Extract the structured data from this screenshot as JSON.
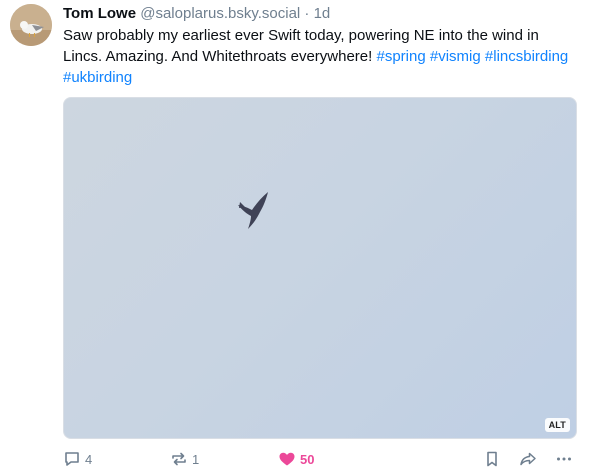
{
  "post": {
    "author": "Tom Lowe",
    "handle": "@saloplarus.bsky.social",
    "separator": "·",
    "time": "1d",
    "text_main": "Saw probably my earliest ever Swift today, powering NE into the wind in Lincs. Amazing. And Whitethroats everywhere! ",
    "hashtags": [
      "#spring",
      "#vismig",
      "#lincsbirding",
      "#ukbirding"
    ],
    "media": {
      "alt_label": "ALT"
    },
    "stats": {
      "replies": "4",
      "reposts": "1",
      "likes": "50"
    }
  },
  "colors": {
    "link": "#1083fe",
    "muted": "#6f7f8f",
    "like": "#ec4899"
  },
  "icons": {
    "reply": "speech-bubble-icon",
    "repost": "repost-arrows-icon",
    "like": "heart-icon",
    "bookmark": "bookmark-icon",
    "share": "share-arrow-icon",
    "more": "more-horizontal-icon"
  }
}
